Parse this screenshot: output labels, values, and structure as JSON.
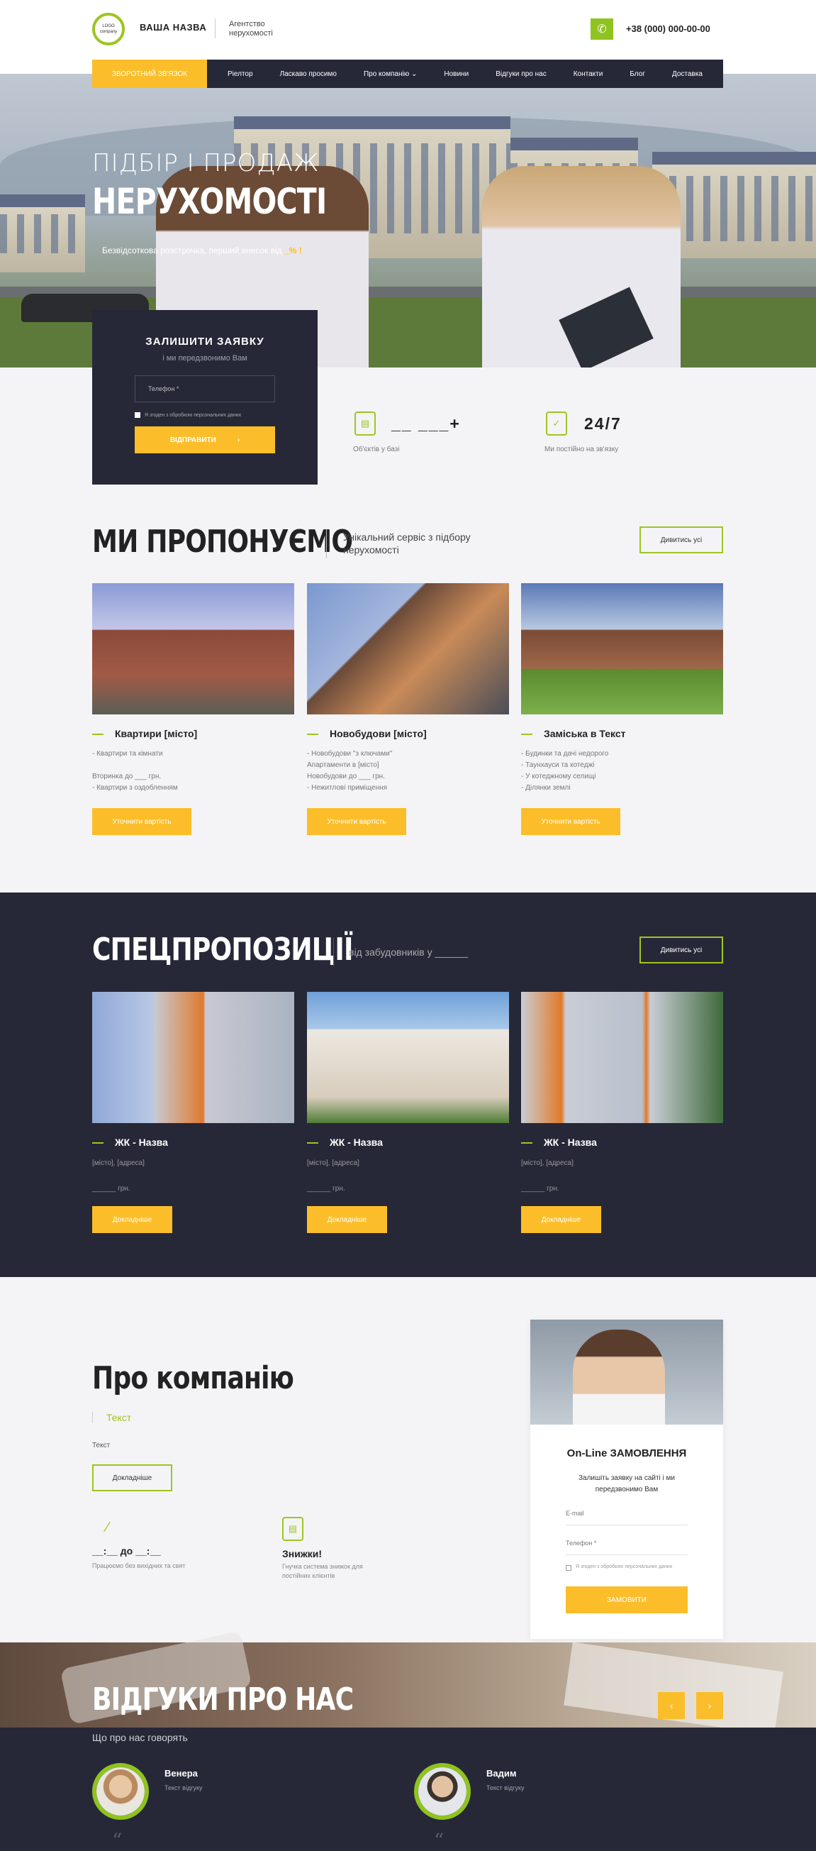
{
  "header": {
    "logo_text_1": "LOGO",
    "logo_text_2": "company",
    "brand": "ВАША НАЗВА",
    "tagline": "Агентство нерухомості",
    "phone": "+38 (000) 000-00-00"
  },
  "nav": {
    "callback_label": "ЗВОРОТНИЙ ЗВ'ЯЗОК",
    "items": [
      "Ріелтор",
      "Ласкаво просимо",
      "Про компанію ⌄",
      "Новини",
      "Відгуки про нас",
      "Контакти",
      "Блог",
      "Доставка"
    ]
  },
  "hero": {
    "subtitle": "ПІДБІР І ПРОДАЖ",
    "title": "НЕРУХОМОСТІ",
    "note_prefix": "Безвідсоткова розстрочка, перший внесок від",
    "note_accent": "_% !"
  },
  "form": {
    "title": "ЗАЛИШИТИ ЗАЯВКУ",
    "subtitle": "і ми передзвонимо Вам",
    "phone_placeholder": "Телефон *",
    "consent": "Я згоден з обробкою персональних даних",
    "submit": "ВІДПРАВИТИ",
    "submit_arrow": "›"
  },
  "stats": [
    {
      "value": "__ ___+",
      "label": "Об'єктів у базі",
      "icon": "building-doc-icon"
    },
    {
      "value": "24/7",
      "label": "Ми постійно на зв'язку",
      "icon": "clipboard-icon"
    }
  ],
  "offers": {
    "title": "МИ ПРОПОНУЄМО",
    "subtitle": "Унікальний сервіс з підбору нерухомості",
    "view_all": "Дивитись усі",
    "cards": [
      {
        "title": "Квартири [місто]",
        "items": [
          "- Квартири та кімнати",
          "",
          "Вторинка до ___ грн.",
          "- Квартири з оздобленням"
        ],
        "button": "Уточнити вартість"
      },
      {
        "title": "Новобудови [місто]",
        "items": [
          "- Новобудови \"з ключами\"",
          "Апартаменти в [місто]",
          "Новобудови до ___ грн.",
          "- Нежитлові приміщення"
        ],
        "button": "Уточнити вартість"
      },
      {
        "title": "Заміська в Текст",
        "items": [
          "- Будинки та дачі недорого",
          "- Таунхауси та котеджі",
          "- У котеджному селищі",
          "- Ділянки землі"
        ],
        "button": "Уточнити вартість"
      }
    ]
  },
  "specials": {
    "title": "СПЕЦПРОПОЗИЦІЇ",
    "subtitle": "від забудовників у ______",
    "view_all": "Дивитись усі",
    "cards": [
      {
        "title": "ЖК - Назва",
        "address": "[місто], [адреса]",
        "price": "______  грн.",
        "button": "Докладніше"
      },
      {
        "title": "ЖК - Назва",
        "address": "[місто], [адреса]",
        "price": "______  грн.",
        "button": "Докладніше"
      },
      {
        "title": "ЖК - Назва",
        "address": "[місто], [адреса]",
        "price": "______  грн.",
        "button": "Докладніше"
      }
    ]
  },
  "about": {
    "title": "Про компанію",
    "accent": "Текст",
    "text": "Текст",
    "button": "Докладніше",
    "features": [
      {
        "title": "__:__ до __:__",
        "text": "Працюємо без вихідних та свят"
      },
      {
        "title": "Знижки!",
        "text": "Гнучка система знижок для постійних клієнтів"
      }
    ]
  },
  "online": {
    "title": "On-Line ЗАМОВЛЕННЯ",
    "subtitle": "Залишіть заявку на сайті і ми передзвонимо Вам",
    "email_placeholder": "E-mail",
    "phone_placeholder": "Телефон *",
    "consent": "Я згоден з обробкою персональних даних",
    "submit": "ЗАМОВИТИ"
  },
  "reviews": {
    "title": "ВІДГУКИ ПРО НАС",
    "subtitle": "Що про нас говорять",
    "prev": "‹",
    "next": "›",
    "items": [
      {
        "name": "Венера",
        "text": "Текст відгуку"
      },
      {
        "name": "Вадим",
        "text": "Текст відгуку"
      }
    ]
  },
  "colors": {
    "accent": "#fbbe2a",
    "green": "#9ec521",
    "dark": "#262838",
    "light": "#f4f4f7"
  }
}
